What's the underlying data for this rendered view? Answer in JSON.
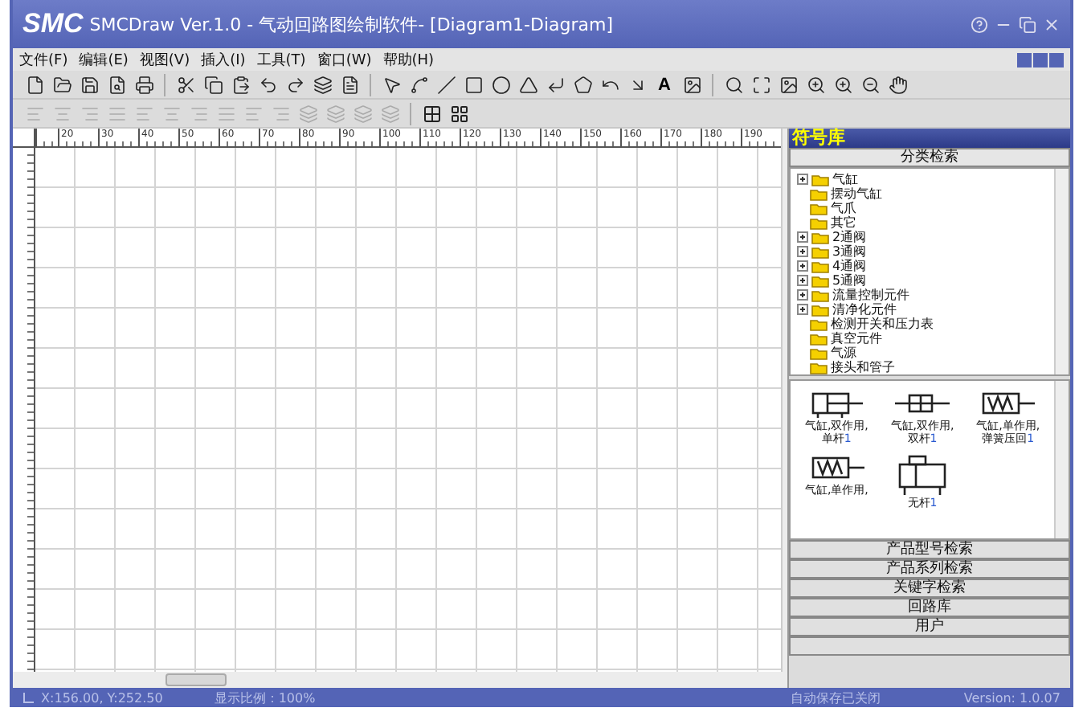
{
  "window": {
    "logo": "SMC",
    "title": "SMCDraw Ver.1.0 - 气动回路图绘制软件- [Diagram1-Diagram]"
  },
  "menu": [
    "文件(F)",
    "编辑(E)",
    "视图(V)",
    "插入(I)",
    "工具(T)",
    "窗口(W)",
    "帮助(H)"
  ],
  "toolbar": {
    "text_tool": "A",
    "format_disabled": true
  },
  "ruler": [
    "20",
    "30",
    "40",
    "50",
    "60",
    "70",
    "80",
    "90",
    "100",
    "110",
    "120",
    "130",
    "140",
    "150",
    "160",
    "170",
    "180",
    "190"
  ],
  "symbol_panel": {
    "title": "符号库",
    "category_button": "分类检索",
    "tree": [
      {
        "label": "气缸",
        "kind": "group",
        "expanded": false
      },
      {
        "label": "摆动气缸",
        "kind": "leaf"
      },
      {
        "label": "气爪",
        "kind": "leaf"
      },
      {
        "label": "其它",
        "kind": "leaf"
      },
      {
        "label": "2通阀",
        "kind": "group",
        "expanded": false
      },
      {
        "label": "3通阀",
        "kind": "group",
        "expanded": false
      },
      {
        "label": "4通阀",
        "kind": "group",
        "expanded": false
      },
      {
        "label": "5通阀",
        "kind": "group",
        "expanded": false
      },
      {
        "label": "流量控制元件",
        "kind": "group",
        "expanded": false
      },
      {
        "label": "清净化元件",
        "kind": "group",
        "expanded": false
      },
      {
        "label": "检测开关和压力表",
        "kind": "leaf"
      },
      {
        "label": "真空元件",
        "kind": "leaf"
      },
      {
        "label": "气源",
        "kind": "leaf"
      },
      {
        "label": "接头和管子",
        "kind": "leaf"
      }
    ],
    "symbols": [
      {
        "name": "气缸,双作用,",
        "name2": "单杆",
        "index": "1",
        "kind": "double"
      },
      {
        "name": "气缸,双作用,",
        "name2": "双杆",
        "index": "1",
        "kind": "through"
      },
      {
        "name": "气缸,单作用,",
        "name2": "弹簧压回",
        "index": "1",
        "kind": "spring"
      },
      {
        "name": "气缸,单作用,",
        "kind": "springout"
      },
      {
        "name": "无杆",
        "index": "1",
        "kind": "rodless"
      }
    ],
    "search_buttons": [
      "产品型号检索",
      "产品系列检索",
      "关键字检索",
      "回路库",
      "用户"
    ]
  },
  "status_bar": {
    "coords": "X:156.00, Y:252.50",
    "zoom": "显示比例：100%",
    "autosave": "自动保存已关闭",
    "version": "Version: 1.0.07"
  }
}
